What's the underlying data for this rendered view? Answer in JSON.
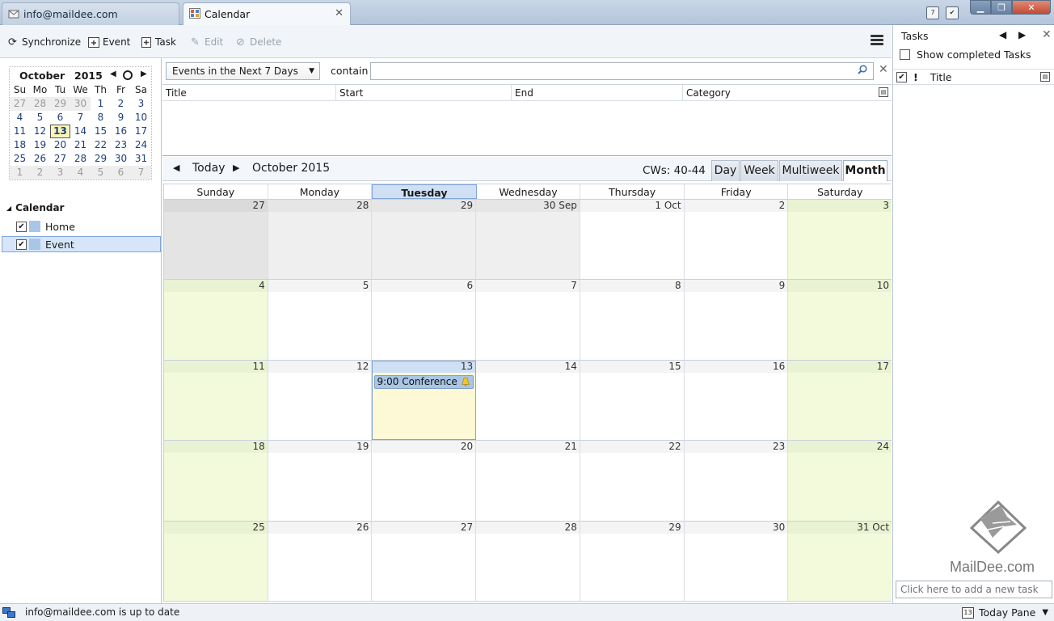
{
  "tabs": [
    {
      "label": "info@maildee.com",
      "icon": "mail-icon"
    },
    {
      "label": "Calendar",
      "icon": "calendar-icon",
      "close": "✕"
    }
  ],
  "window": {
    "minimize": "▁",
    "maximize": "❐",
    "close": "✕"
  },
  "toolbar": {
    "sync_label": "Synchronize",
    "event_label": "Event",
    "task_label": "Task",
    "edit_label": "Edit",
    "delete_label": "Delete"
  },
  "minimonth": {
    "month": "October",
    "year": "2015",
    "prev": "◀",
    "next": "▶",
    "weekdays": [
      "Su",
      "Mo",
      "Tu",
      "We",
      "Th",
      "Fr",
      "Sa"
    ],
    "weeks": [
      [
        "27",
        "28",
        "29",
        "30",
        "1",
        "2",
        "3"
      ],
      [
        "4",
        "5",
        "6",
        "7",
        "8",
        "9",
        "10"
      ],
      [
        "11",
        "12",
        "13",
        "14",
        "15",
        "16",
        "17"
      ],
      [
        "18",
        "19",
        "20",
        "21",
        "22",
        "23",
        "24"
      ],
      [
        "25",
        "26",
        "27",
        "28",
        "29",
        "30",
        "31"
      ],
      [
        "1",
        "2",
        "3",
        "4",
        "5",
        "6",
        "7"
      ]
    ]
  },
  "calendars": {
    "header": "Calendar",
    "items": [
      {
        "name": "Home",
        "checked": "✔"
      },
      {
        "name": "Event",
        "checked": "✔"
      }
    ]
  },
  "filter": {
    "selected": "Events in the Next 7 Days",
    "contain_label": "contain",
    "search_value": "",
    "search_placeholder": ""
  },
  "eventlist": {
    "columns": [
      "Title",
      "Start",
      "End",
      "Category"
    ]
  },
  "calnav": {
    "today": "Today",
    "month_label": "October 2015",
    "cws": "CWs: 40-44",
    "views": [
      "Day",
      "Week",
      "Multiweek",
      "Month"
    ],
    "active_view": "Month"
  },
  "monthview": {
    "weekday_headers": [
      "Sunday",
      "Monday",
      "Tuesday",
      "Wednesday",
      "Thursday",
      "Friday",
      "Saturday"
    ],
    "weeks": [
      [
        "27",
        "28",
        "29",
        "30 Sep",
        "1 Oct",
        "2",
        "3"
      ],
      [
        "4",
        "5",
        "6",
        "7",
        "8",
        "9",
        "10"
      ],
      [
        "11",
        "12",
        "13",
        "14",
        "15",
        "16",
        "17"
      ],
      [
        "18",
        "19",
        "20",
        "21",
        "22",
        "23",
        "24"
      ],
      [
        "25",
        "26",
        "27",
        "28",
        "29",
        "30",
        "31 Oct"
      ]
    ],
    "event": {
      "label": "9:00 Conference",
      "day": "13"
    }
  },
  "status": {
    "text": "info@maildee.com is up to date",
    "today_pane": "Today Pane",
    "today_pane_day": "13"
  },
  "tasks": {
    "title": "Tasks",
    "show_completed": "Show completed Tasks",
    "priority_col": "!",
    "title_col": "Title",
    "new_task_placeholder": "Click here to add a new task"
  },
  "logo": {
    "text": "MailDee.com"
  }
}
